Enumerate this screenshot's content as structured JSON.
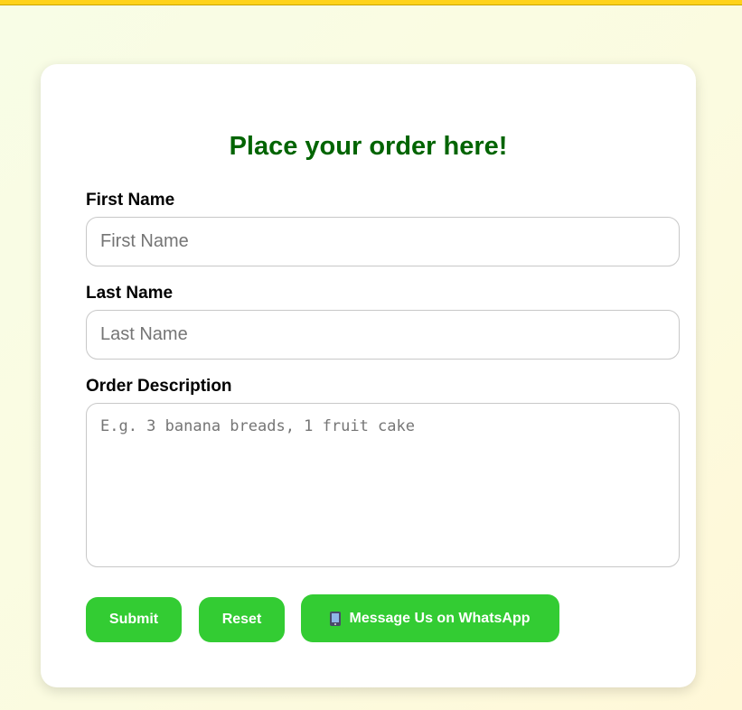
{
  "form": {
    "title": "Place your order here!",
    "first_name": {
      "label": "First Name",
      "placeholder": "First Name",
      "value": ""
    },
    "last_name": {
      "label": "Last Name",
      "placeholder": "Last Name",
      "value": ""
    },
    "order_description": {
      "label": "Order Description",
      "placeholder": "E.g. 3 banana breads, 1 fruit cake",
      "value": ""
    },
    "buttons": {
      "submit": "Submit",
      "reset": "Reset",
      "whatsapp": "Message Us on WhatsApp",
      "whatsapp_icon": "mobile-phone-icon"
    }
  },
  "colors": {
    "title": "#006400",
    "button": "#33cc33",
    "top_bar": "#ffd21a"
  }
}
